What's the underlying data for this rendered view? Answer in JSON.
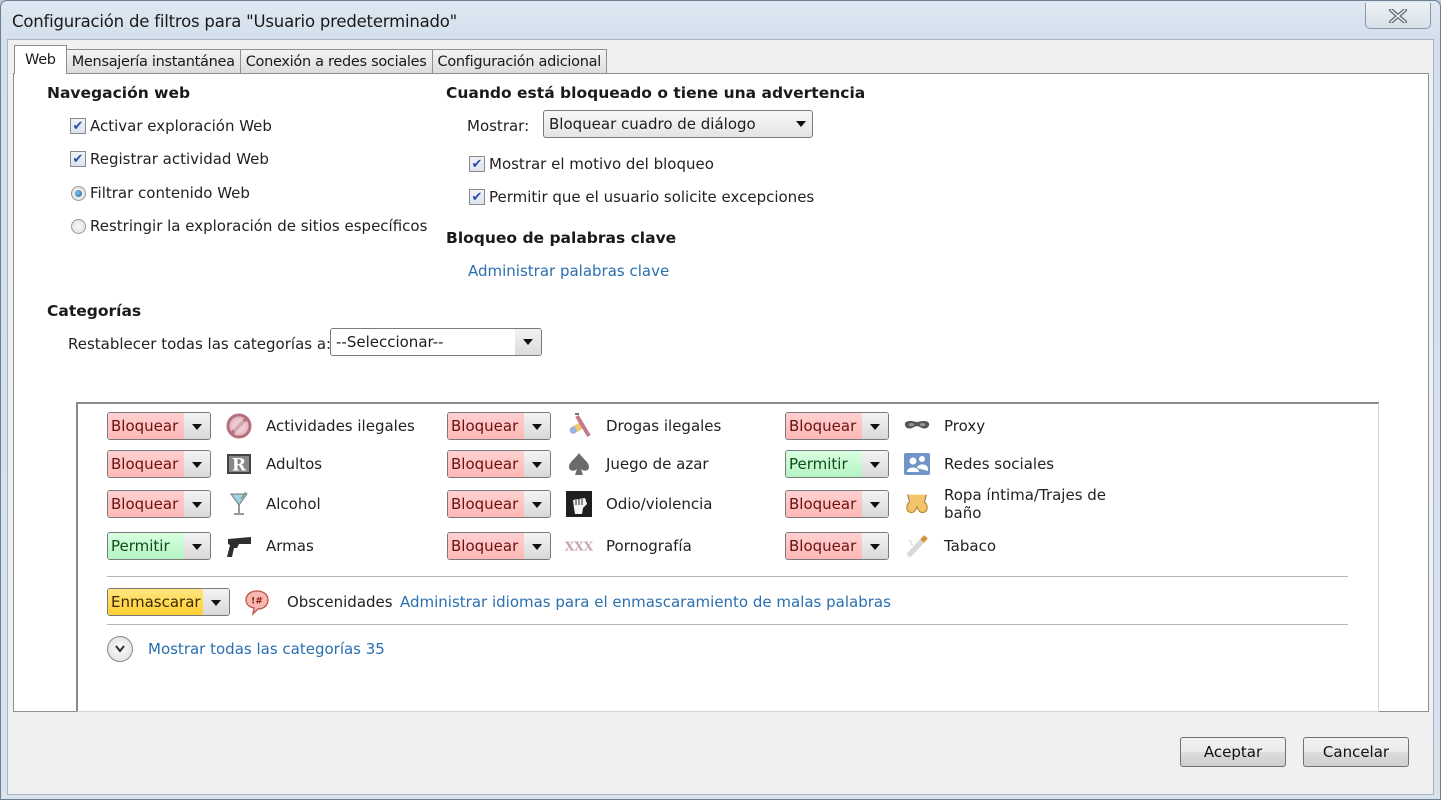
{
  "window": {
    "title": "Configuración de filtros para \"Usuario predeterminado\"",
    "close_icon": "close-x-icon"
  },
  "tabs": [
    {
      "label": "Web",
      "active": true
    },
    {
      "label": "Mensajería instantánea",
      "active": false
    },
    {
      "label": "Conexión a redes sociales",
      "active": false
    },
    {
      "label": "Configuración adicional",
      "active": false
    }
  ],
  "web_navigation": {
    "title": "Navegación web",
    "options": [
      {
        "type": "checkbox",
        "label": "Activar exploración Web",
        "checked": true
      },
      {
        "type": "checkbox",
        "label": "Registrar actividad Web",
        "checked": true
      },
      {
        "type": "radio",
        "label": "Filtrar contenido Web",
        "checked": true
      },
      {
        "type": "radio",
        "label": "Restringir la exploración de sitios específicos",
        "checked": false
      }
    ]
  },
  "blocked_warning": {
    "title": "Cuando está bloqueado o tiene una advertencia",
    "show_label": "Mostrar:",
    "show_value": "Bloquear cuadro de diálogo",
    "options": [
      {
        "label": "Mostrar el motivo del bloqueo",
        "checked": true
      },
      {
        "label": "Permitir que el usuario solicite excepciones",
        "checked": true
      }
    ]
  },
  "keyword_block": {
    "title": "Bloqueo de palabras clave",
    "link": "Administrar palabras clave"
  },
  "categories": {
    "title": "Categorías",
    "reset_label": "Restablecer todas las categorías a:",
    "reset_value": "--Seleccionar--",
    "columns": [
      [
        {
          "action": "Bloquear",
          "state": "block",
          "icon": "prohibited-icon",
          "label": "Actividades ilegales"
        },
        {
          "action": "Bloquear",
          "state": "block",
          "icon": "r-rating-icon",
          "label": "Adultos"
        },
        {
          "action": "Bloquear",
          "state": "block",
          "icon": "cocktail-glass-icon",
          "label": "Alcohol"
        },
        {
          "action": "Permitir",
          "state": "allow",
          "icon": "pistol-icon",
          "label": "Armas"
        }
      ],
      [
        {
          "action": "Bloquear",
          "state": "block",
          "icon": "pills-syringe-icon",
          "label": "Drogas ilegales"
        },
        {
          "action": "Bloquear",
          "state": "block",
          "icon": "spade-icon",
          "label": "Juego de azar"
        },
        {
          "action": "Bloquear",
          "state": "block",
          "icon": "fist-icon",
          "label": "Odio/violencia"
        },
        {
          "action": "Bloquear",
          "state": "block",
          "icon": "xxx-icon",
          "label": "Pornografía"
        }
      ],
      [
        {
          "action": "Bloquear",
          "state": "block",
          "icon": "mask-icon",
          "label": "Proxy"
        },
        {
          "action": "Permitir",
          "state": "allow",
          "icon": "social-people-icon",
          "label": "Redes sociales"
        },
        {
          "action": "Bloquear",
          "state": "block",
          "icon": "bra-icon",
          "label": "Ropa íntima/Trajes de baño"
        },
        {
          "action": "Bloquear",
          "state": "block",
          "icon": "cigarette-icon",
          "label": "Tabaco"
        }
      ]
    ],
    "obscenities": {
      "action": "Enmascarar",
      "state": "mask",
      "icon": "speech-bubble-curse-icon",
      "label": "Obscenidades",
      "link": "Administrar idiomas para el enmascaramiento de malas palabras"
    },
    "show_all_link": "Mostrar todas las categorías 35"
  },
  "buttons": {
    "accept": "Aceptar",
    "cancel": "Cancelar"
  },
  "colors": {
    "link": "#2a6fb0",
    "block": "#ffc0c0",
    "allow": "#c2f5cd",
    "mask": "#ffd740"
  }
}
